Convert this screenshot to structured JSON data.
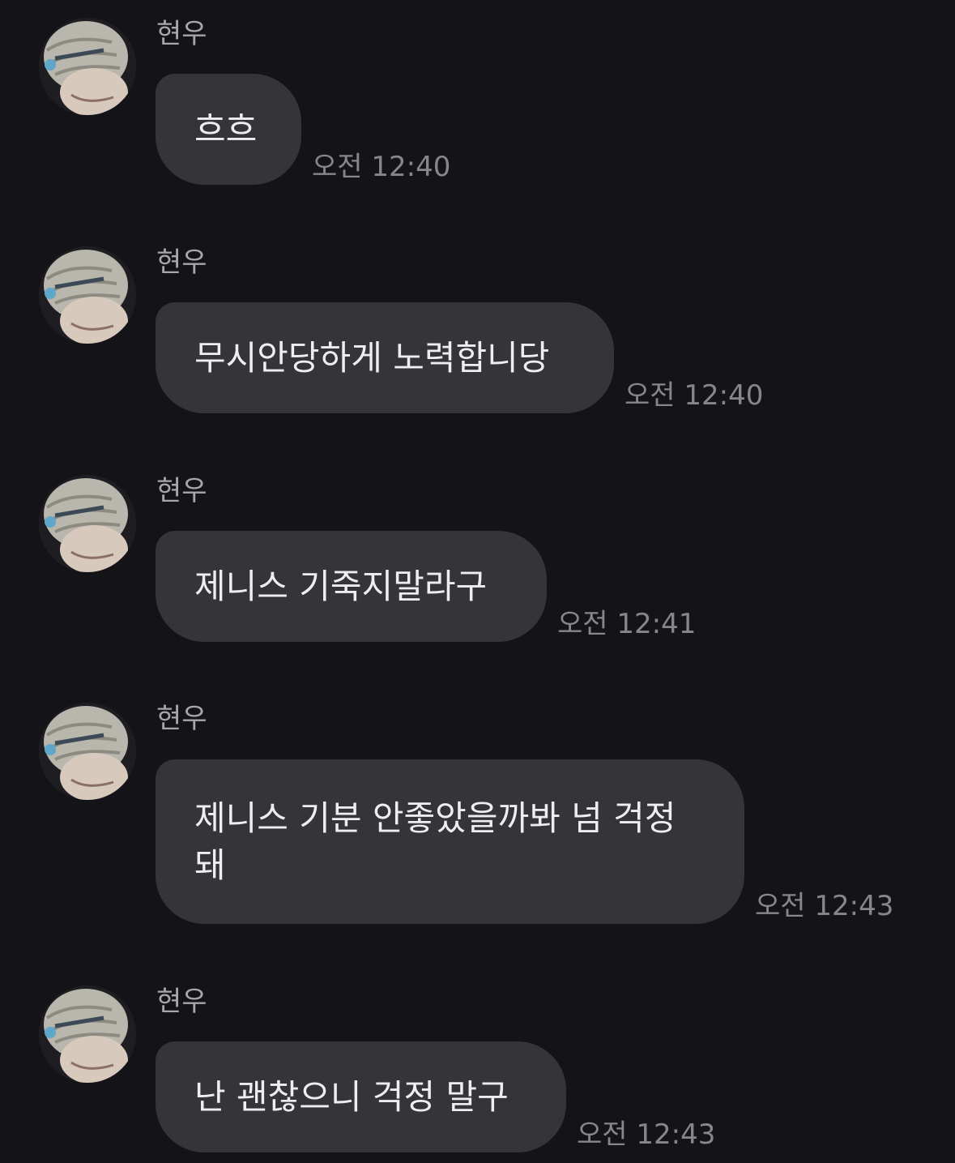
{
  "messages": [
    {
      "sender": "현우",
      "text": "흐흐",
      "time": "오전 12:40",
      "avatar_icon": "profile-photo"
    },
    {
      "sender": "현우",
      "text": "무시안당하게 노력합니당",
      "time": "오전 12:40",
      "avatar_icon": "profile-photo"
    },
    {
      "sender": "현우",
      "text": "제니스 기죽지말라구",
      "time": "오전 12:41",
      "avatar_icon": "profile-photo"
    },
    {
      "sender": "현우",
      "text": "제니스 기분 안좋았을까봐 넘 걱정\n돼",
      "time": "오전 12:43",
      "avatar_icon": "profile-photo"
    },
    {
      "sender": "현우",
      "text": "난 괜찮으니 걱정 말구",
      "time": "오전 12:43",
      "avatar_icon": "profile-photo"
    }
  ],
  "colors": {
    "background": "#141418",
    "bubble": "#343439",
    "sender_text": "#a6a6ab",
    "time_text": "#86868c"
  }
}
